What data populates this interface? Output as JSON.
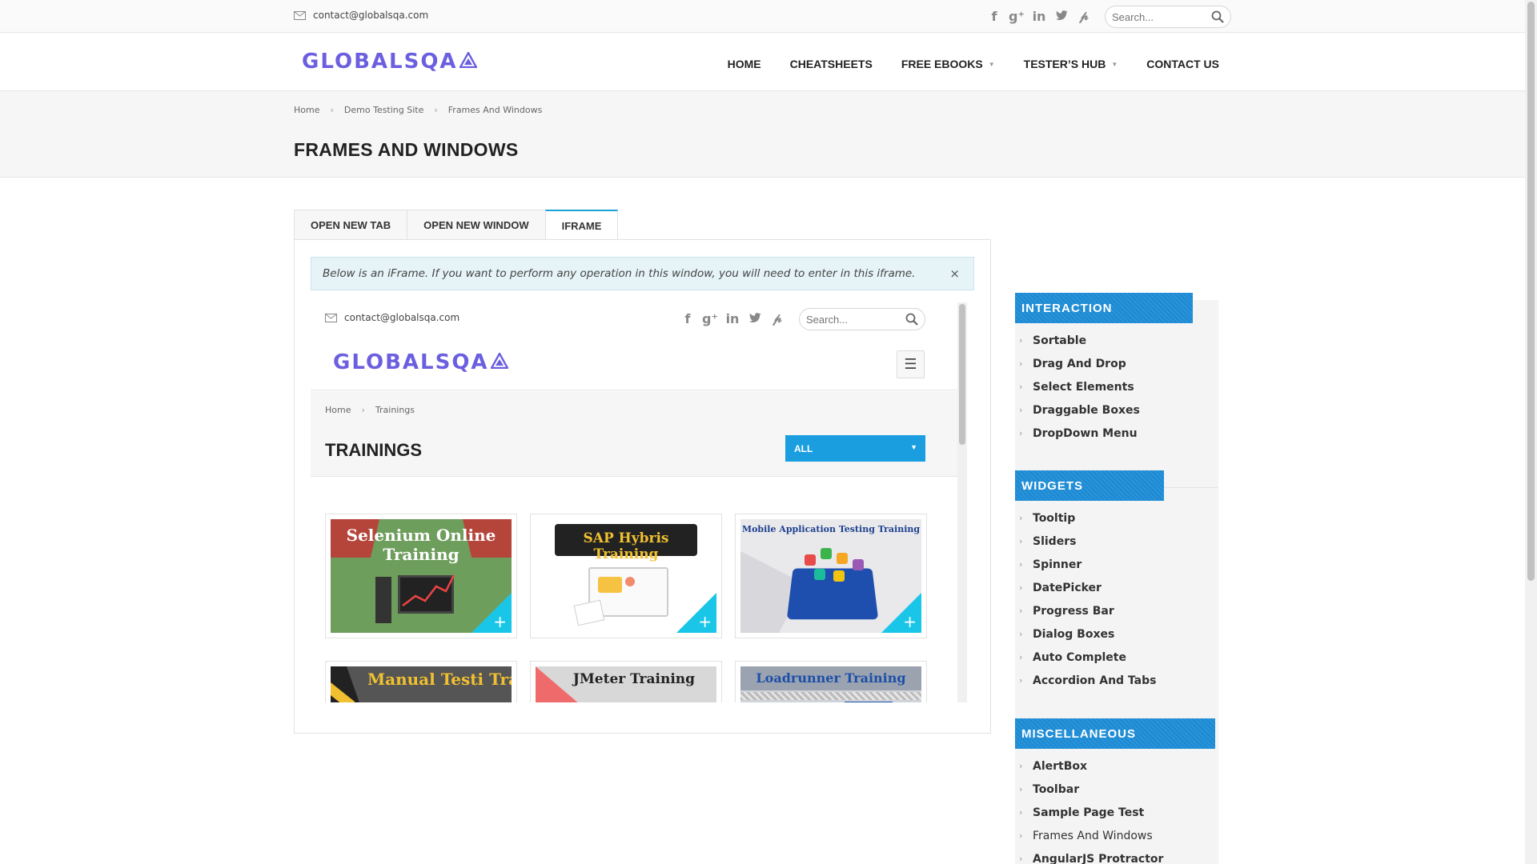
{
  "topbar": {
    "email": "contact@globalsqa.com",
    "social_icons": [
      "facebook-icon",
      "google-plus-icon",
      "linkedin-icon",
      "twitter-icon",
      "pinterest-icon"
    ],
    "search_placeholder": "Search..."
  },
  "header": {
    "logo": "GLOBALSQA",
    "nav": [
      {
        "label": "HOME",
        "dropdown": false
      },
      {
        "label": "CHEATSHEETS",
        "dropdown": false
      },
      {
        "label": "FREE EBOOKS",
        "dropdown": true
      },
      {
        "label": "TESTER’S HUB",
        "dropdown": true
      },
      {
        "label": "CONTACT US",
        "dropdown": false
      }
    ]
  },
  "breadcrumb": [
    "Home",
    "Demo Testing Site",
    "Frames And Windows"
  ],
  "page_title": "FRAMES AND WINDOWS",
  "tabs": [
    {
      "label": "OPEN NEW TAB",
      "active": false
    },
    {
      "label": "OPEN NEW WINDOW",
      "active": false
    },
    {
      "label": "IFRAME",
      "active": true
    }
  ],
  "alert": {
    "text": "Below is an iFrame. If you want to perform any operation in this window, you will need to enter in this iframe.",
    "close": "×"
  },
  "iframe": {
    "email": "contact@globalsqa.com",
    "search_placeholder": "Search...",
    "logo": "GLOBALSQA",
    "breadcrumb": [
      "Home",
      "Trainings"
    ],
    "title": "TRAININGS",
    "filter": "ALL",
    "cards": [
      {
        "label": "Selenium Online Training"
      },
      {
        "label": "SAP Hybris Training"
      },
      {
        "label": "Mobile Application Testing Training"
      },
      {
        "label": "Manual Testi Training"
      },
      {
        "label": "JMeter Training"
      },
      {
        "label": "Loadrunner Training"
      }
    ]
  },
  "sidebar": {
    "sections": [
      {
        "title": "INTERACTION",
        "items": [
          "Sortable",
          "Drag And Drop",
          "Select Elements",
          "Draggable Boxes",
          "DropDown Menu"
        ]
      },
      {
        "title": "WIDGETS",
        "items": [
          "Tooltip",
          "Sliders",
          "Spinner",
          "DatePicker",
          "Progress Bar",
          "Dialog Boxes",
          "Auto Complete",
          "Accordion And Tabs"
        ]
      },
      {
        "title": "MISCELLANEOUS",
        "items": [
          "AlertBox",
          "Toolbar",
          "Sample Page Test",
          "Frames And Windows",
          "AngularJS Protractor Practice"
        ]
      }
    ]
  },
  "colors": {
    "brand": "#6b5fe0",
    "accent": "#1a9ee0",
    "sidebar_header": "#1a8ad4"
  }
}
